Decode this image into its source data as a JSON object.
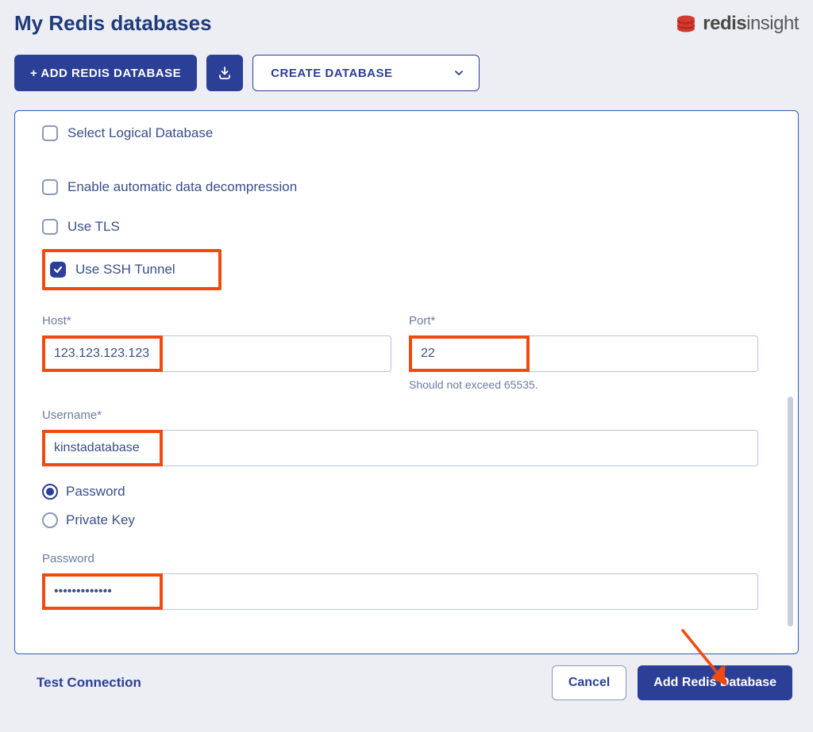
{
  "header": {
    "title": "My Redis databases",
    "brand_prefix": "redis",
    "brand_suffix": "insight"
  },
  "actions": {
    "add_label": "+ ADD REDIS DATABASE",
    "create_label": "CREATE DATABASE"
  },
  "form": {
    "checks": {
      "logical": "Select Logical Database",
      "decompress": "Enable automatic data decompression",
      "tls": "Use TLS",
      "ssh": "Use SSH Tunnel"
    },
    "host": {
      "label": "Host*",
      "value": "123.123.123.123"
    },
    "port": {
      "label": "Port*",
      "value": "22",
      "hint": "Should not exceed 65535."
    },
    "username": {
      "label": "Username*",
      "value": "kinstadatabase"
    },
    "auth": {
      "password_label": "Password",
      "privatekey_label": "Private Key"
    },
    "password": {
      "label": "Password",
      "value": "•••••••••••••"
    }
  },
  "footer": {
    "test": "Test Connection",
    "cancel": "Cancel",
    "submit": "Add Redis Database"
  }
}
